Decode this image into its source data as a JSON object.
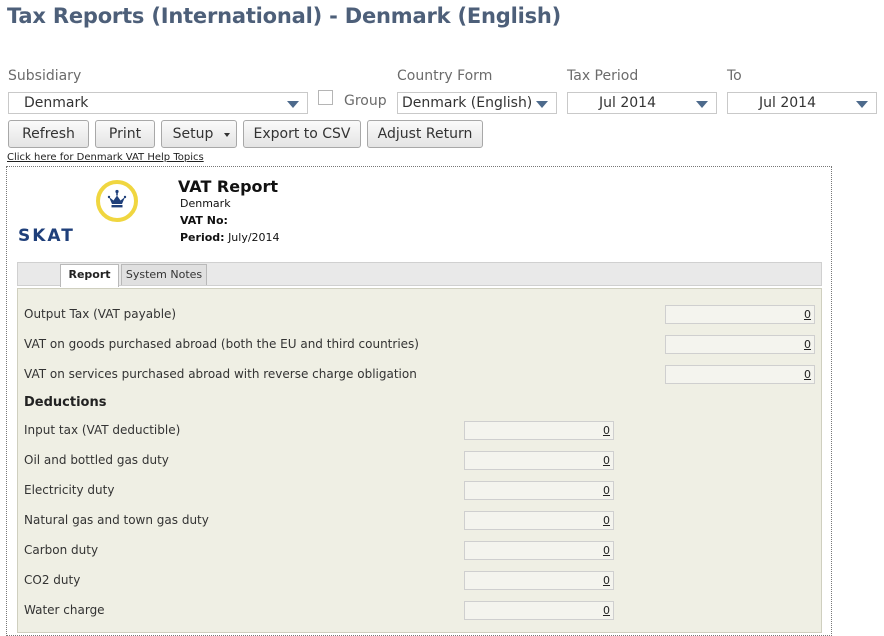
{
  "page": {
    "title": "Tax Reports (International) - Denmark (English)"
  },
  "filters": {
    "subsidiary": {
      "label": "Subsidiary",
      "value": "Denmark"
    },
    "group": {
      "label": "Group",
      "checked": false
    },
    "country_form": {
      "label": "Country Form",
      "value": "Denmark (English)"
    },
    "tax_period": {
      "label": "Tax Period",
      "value": "Jul 2014"
    },
    "to": {
      "label": "To",
      "value": "Jul 2014"
    }
  },
  "toolbar": {
    "refresh": "Refresh",
    "print": "Print",
    "setup": "Setup",
    "export": "Export to CSV",
    "adjust": "Adjust Return"
  },
  "help_link": "Click here for Denmark VAT Help Topics",
  "report": {
    "logo_text": "SKAT",
    "title": "VAT Report",
    "country": "Denmark",
    "vat_no_label": "VAT No:",
    "vat_no_value": "",
    "period_label": "Period:",
    "period_value": "July/2014"
  },
  "tabs": [
    {
      "label": "Report",
      "active": true
    },
    {
      "label": "System Notes",
      "active": false
    }
  ],
  "output_rows": [
    {
      "label": "Output Tax (VAT payable)",
      "value": "0"
    },
    {
      "label": "VAT on goods purchased abroad (both the EU and third countries)",
      "value": "0"
    },
    {
      "label": "VAT on services purchased abroad with reverse charge obligation",
      "value": "0"
    }
  ],
  "deductions": {
    "heading": "Deductions",
    "rows": [
      {
        "label": "Input tax (VAT deductible)",
        "value": "0"
      },
      {
        "label": "Oil and bottled gas duty",
        "value": "0"
      },
      {
        "label": "Electricity duty",
        "value": "0"
      },
      {
        "label": "Natural gas and town gas duty",
        "value": "0"
      },
      {
        "label": "Carbon duty",
        "value": "0"
      },
      {
        "label": "CO2 duty",
        "value": "0"
      },
      {
        "label": "Water charge",
        "value": "0"
      }
    ]
  }
}
